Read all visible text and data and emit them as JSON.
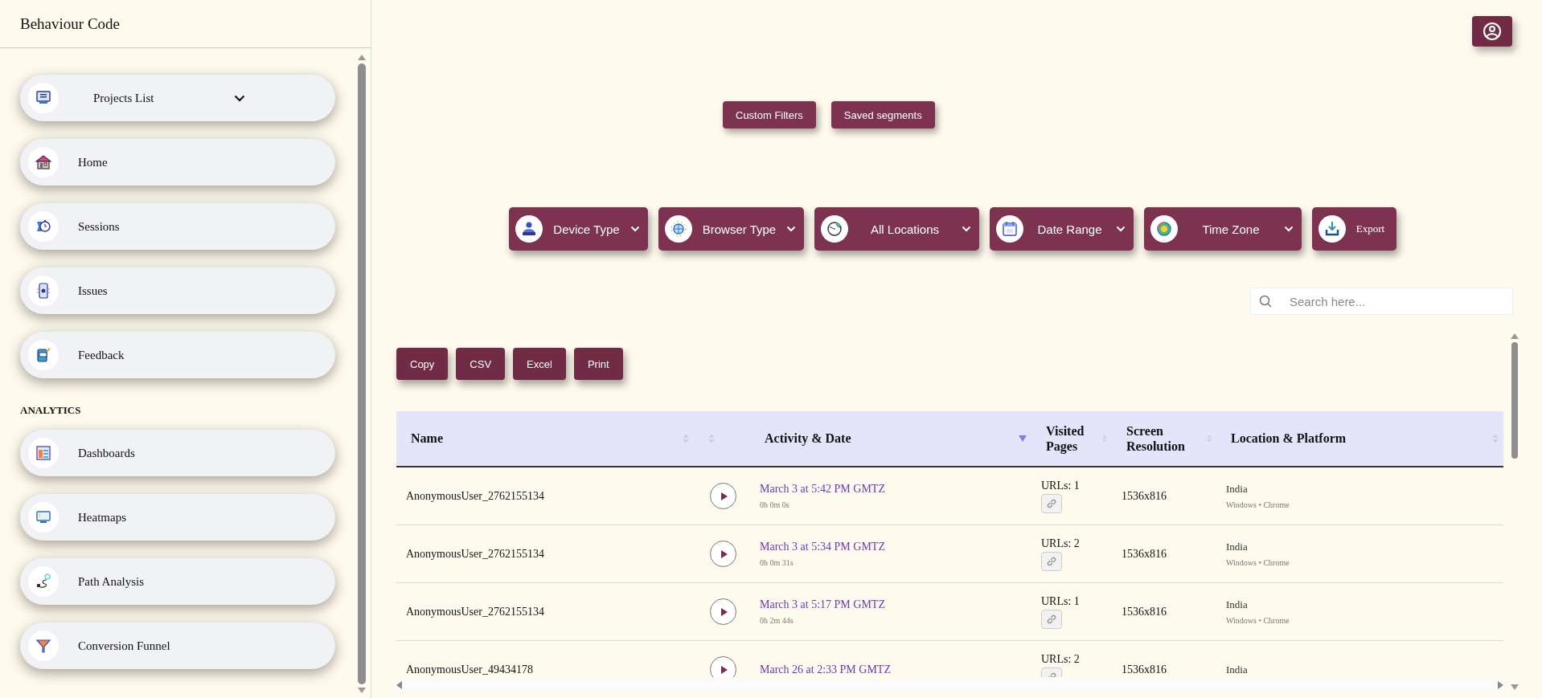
{
  "sidebar": {
    "title": "Behaviour Code",
    "sections": [
      {
        "items": [
          {
            "label": "Projects List",
            "kind": "dropdown"
          },
          {
            "label": "Home",
            "kind": "link"
          },
          {
            "label": "Sessions",
            "kind": "link"
          },
          {
            "label": "Issues",
            "kind": "link"
          },
          {
            "label": "Feedback",
            "kind": "link"
          }
        ]
      },
      {
        "header": "ANALYTICS",
        "items": [
          {
            "label": "Dashboards",
            "kind": "link"
          },
          {
            "label": "Heatmaps",
            "kind": "link"
          },
          {
            "label": "Path Analysis",
            "kind": "link"
          },
          {
            "label": "Conversion Funnel",
            "kind": "link"
          }
        ]
      }
    ]
  },
  "segment_buttons": [
    "Custom Filters",
    "Saved segments"
  ],
  "filters": [
    {
      "label": "Device Type",
      "kind": "dropdown"
    },
    {
      "label": "Browser Type",
      "kind": "dropdown"
    },
    {
      "label": "All Locations",
      "kind": "dropdown"
    },
    {
      "label": "Date Range",
      "kind": "dropdown"
    },
    {
      "label": "Time Zone",
      "kind": "dropdown"
    },
    {
      "label": "Export",
      "kind": "action"
    }
  ],
  "search": {
    "placeholder": "Search here..."
  },
  "export_buttons": [
    "Copy",
    "CSV",
    "Excel",
    "Print"
  ],
  "table": {
    "columns": [
      {
        "label": "Name",
        "sorted": false
      },
      {
        "sorted": false
      },
      {
        "label": "Activity & Date",
        "sorted": true
      },
      {
        "label": "Visited Pages",
        "sorted": false
      },
      {
        "label": "Screen Resolution",
        "sorted": false
      },
      {
        "label": "Location & Platform",
        "sorted": false
      }
    ],
    "rows": [
      {
        "name": "AnonymousUser_2762155134",
        "activity": "March 3 at 5:42 PM GMTZ",
        "duration": "0h 0m 0s",
        "urls": "URLs: 1",
        "resolution": "1536x816",
        "location": "India",
        "platform": "Windows • Chrome"
      },
      {
        "name": "AnonymousUser_2762155134",
        "activity": "March 3 at 5:34 PM GMTZ",
        "duration": "0h 0m 31s",
        "urls": "URLs: 2",
        "resolution": "1536x816",
        "location": "India",
        "platform": "Windows • Chrome"
      },
      {
        "name": "AnonymousUser_2762155134",
        "activity": "March 3 at 5:17 PM GMTZ",
        "duration": "0h 2m 44s",
        "urls": "URLs: 1",
        "resolution": "1536x816",
        "location": "India",
        "platform": "Windows • Chrome"
      },
      {
        "name": "AnonymousUser_49434178",
        "activity": "March 26 at 2:33 PM GMTZ",
        "urls": "URLs: 2",
        "resolution": "1536x816",
        "location": "India"
      }
    ]
  }
}
